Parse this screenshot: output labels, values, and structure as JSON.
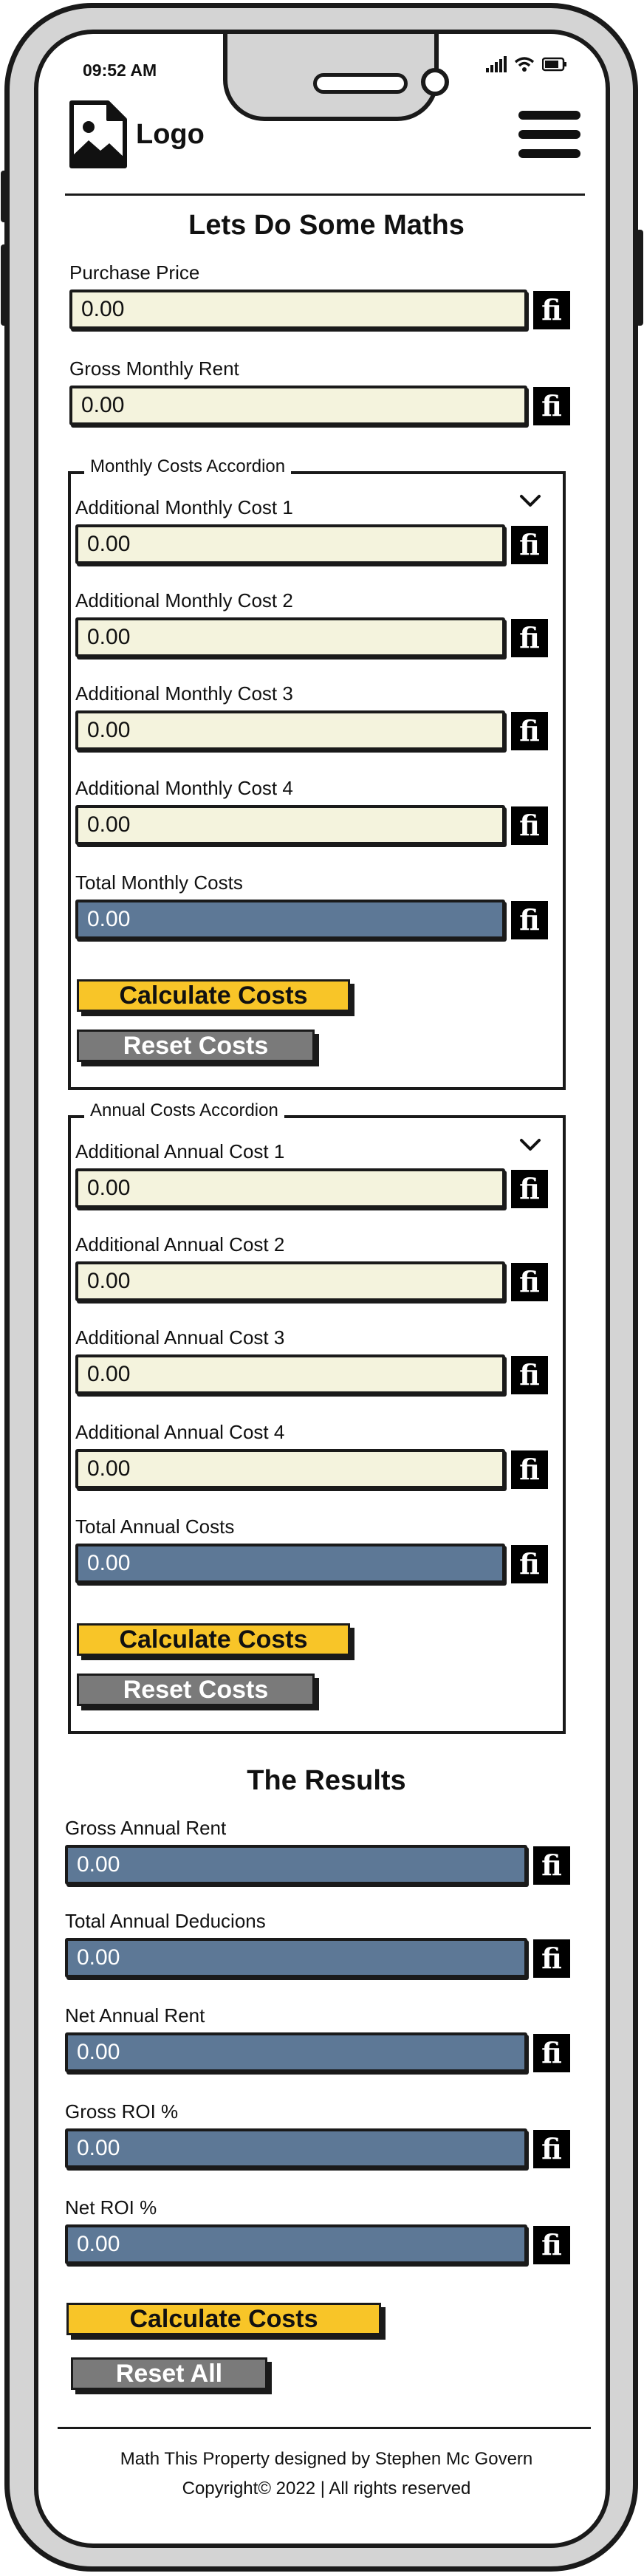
{
  "status_bar": {
    "time": "09:52 AM"
  },
  "header": {
    "logo_label": "Logo"
  },
  "page_title": "Lets Do Some Maths",
  "fields": {
    "purchase_price": {
      "label": "Purchase Price",
      "value": "0.00"
    },
    "gross_monthly_rent": {
      "label": "Gross Monthly Rent",
      "value": "0.00"
    }
  },
  "fi_label": "fi",
  "monthly_accordion": {
    "legend": "Monthly Costs Accordion",
    "items": [
      {
        "label": "Additional Monthly Cost 1",
        "value": "0.00"
      },
      {
        "label": "Additional Monthly Cost 2",
        "value": "0.00"
      },
      {
        "label": "Additional Monthly Cost 3",
        "value": "0.00"
      },
      {
        "label": "Additional Monthly Cost 4",
        "value": "0.00"
      }
    ],
    "total": {
      "label": "Total Monthly Costs",
      "value": "0.00"
    },
    "calculate_label": "Calculate Costs",
    "reset_label": "Reset Costs"
  },
  "annual_accordion": {
    "legend": "Annual Costs Accordion",
    "items": [
      {
        "label": "Additional Annual Cost 1",
        "value": "0.00"
      },
      {
        "label": "Additional Annual Cost 2",
        "value": "0.00"
      },
      {
        "label": "Additional Annual Cost 3",
        "value": "0.00"
      },
      {
        "label": "Additional Annual Cost 4",
        "value": "0.00"
      }
    ],
    "total": {
      "label": "Total Annual Costs",
      "value": "0.00"
    },
    "calculate_label": "Calculate Costs",
    "reset_label": "Reset Costs"
  },
  "results": {
    "title": "The Results",
    "items": [
      {
        "label": "Gross Annual Rent",
        "value": "0.00"
      },
      {
        "label": "Total Annual Deducions",
        "value": "0.00"
      },
      {
        "label": "Net Annual Rent",
        "value": "0.00"
      },
      {
        "label": "Gross ROI %",
        "value": "0.00"
      },
      {
        "label": "Net ROI %",
        "value": "0.00"
      }
    ],
    "calculate_label": "Calculate Costs",
    "reset_label": "Reset All"
  },
  "footer": {
    "line1": "Math This Property designed by Stephen Mc Govern",
    "line2": "Copyright© 2022 | All rights reserved"
  },
  "colors": {
    "input_bg": "#f4f3dd",
    "output_bg": "#5d7896",
    "calculate_bg": "#f8c528",
    "reset_bg": "#7a7a7a"
  },
  "icons": [
    "image-icon",
    "hamburger-icon",
    "signal-icon",
    "wifi-icon",
    "battery-icon",
    "chevron-down-icon",
    "fi-icon"
  ]
}
